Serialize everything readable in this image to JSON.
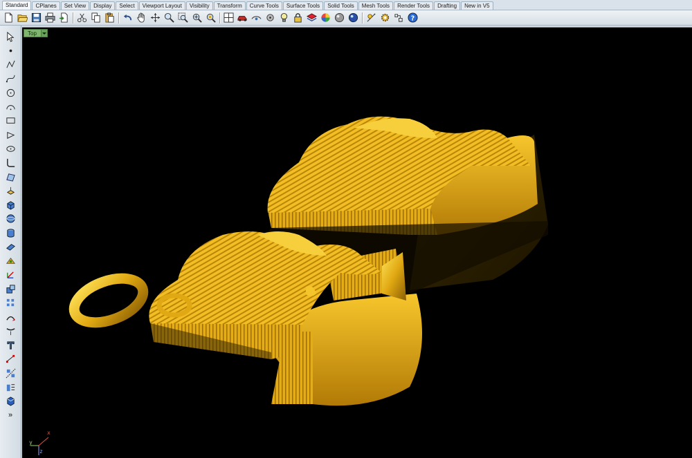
{
  "tabs": [
    "Standard",
    "CPlanes",
    "Set View",
    "Display",
    "Select",
    "Viewport Layout",
    "Visibility",
    "Transform",
    "Curve Tools",
    "Surface Tools",
    "Solid Tools",
    "Mesh Tools",
    "Render Tools",
    "Drafting",
    "New in V5"
  ],
  "toolbar": {
    "icons": [
      "new-file-icon",
      "open-file-icon",
      "save-icon",
      "print-icon",
      "import-icon",
      "cut-icon",
      "copy-icon",
      "paste-icon",
      "undo-icon",
      "pan-hand-icon",
      "move-view-icon",
      "zoom-icon",
      "zoom-window-icon",
      "zoom-extents-icon",
      "zoom-selected-icon",
      "four-viewports-icon",
      "car-render-icon",
      "display-mode-icon",
      "point-icon",
      "light-bulb-icon",
      "lock-icon",
      "layer-icon",
      "material-color-icon",
      "render-preview-icon",
      "render-icon",
      "sun-icon",
      "options-gear-icon",
      "text-object-icon",
      "help-icon"
    ]
  },
  "left_toolbar": {
    "icons": [
      "select-arrow-icon",
      "point-icon",
      "polyline-icon",
      "curve-icon",
      "circle-icon",
      "arc-icon",
      "rectangle-icon",
      "polygon-icon",
      "ellipse-icon",
      "fillet-curve-icon",
      "surface-from-points-icon",
      "extrude-icon",
      "box-icon",
      "sphere-icon",
      "cylinder-icon",
      "planar-surface-icon",
      "transform-icon",
      "gumball-icon",
      "boolean-icon",
      "array-icon",
      "join-icon",
      "explode-icon",
      "text-icon",
      "dimension-icon",
      "mirror-icon",
      "grid-snap-icon",
      "solid-box-icon",
      "more-arrows-icon"
    ],
    "more_label": "»"
  },
  "viewport": {
    "name": "Top",
    "background": "#000000",
    "model_color": "#e0a812"
  },
  "axis": {
    "x": "x",
    "y": "y",
    "z": "z"
  }
}
